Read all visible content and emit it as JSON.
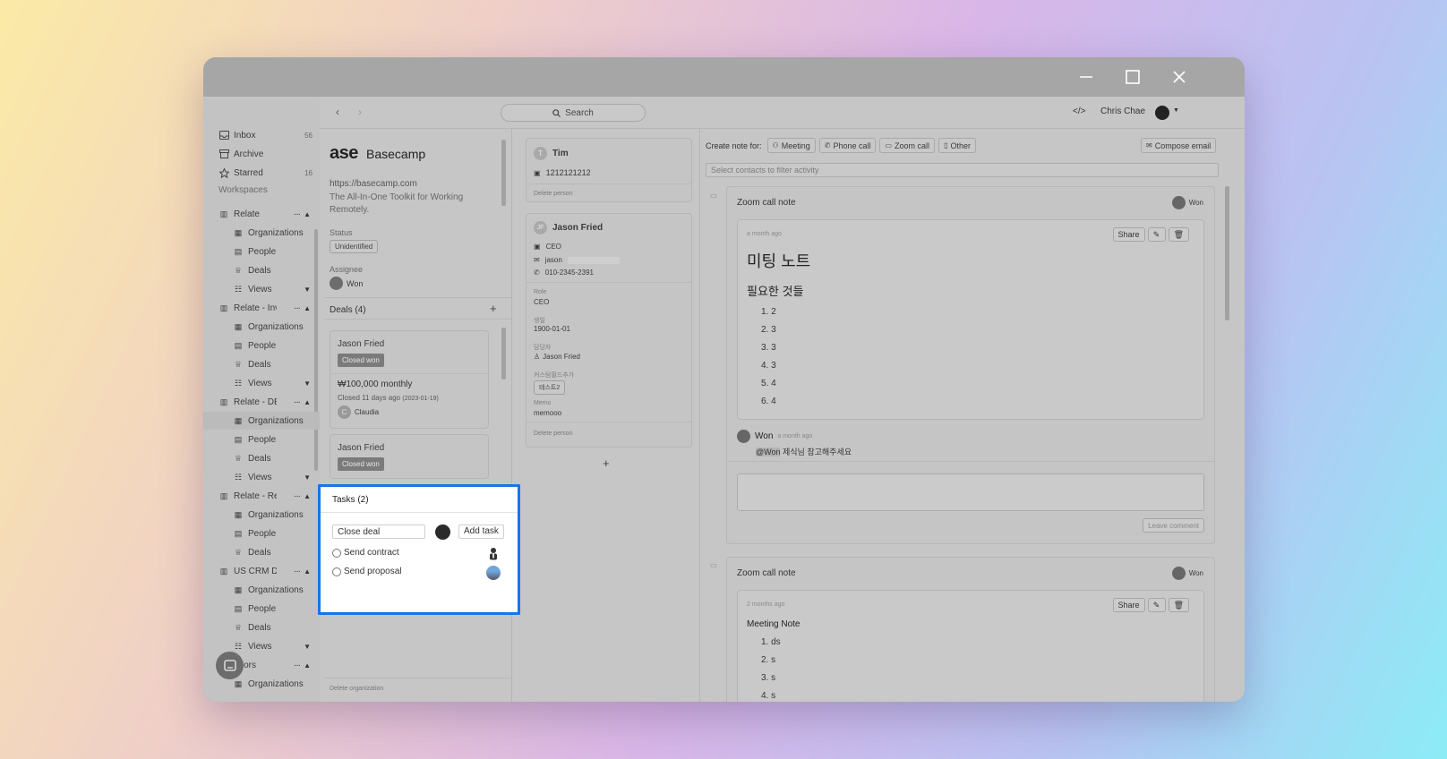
{
  "window": {
    "minimize_label": "—",
    "maximize_label": "☐",
    "close_label": "✕"
  },
  "sidebar": {
    "inbox": {
      "label": "Inbox",
      "count": "56"
    },
    "archive": {
      "label": "Archive"
    },
    "starred": {
      "label": "Starred",
      "count": "16"
    },
    "workspaces_label": "Workspaces",
    "workspaces": [
      {
        "name": "Relate",
        "items": [
          "Organizations",
          "People",
          "Deals",
          "Views"
        ]
      },
      {
        "name": "Relate - Inve",
        "items": [
          "Organizations",
          "People",
          "Deals",
          "Views"
        ]
      },
      {
        "name": "Relate - DEM",
        "items": [
          "Organizations",
          "People",
          "Deals",
          "Views"
        ]
      },
      {
        "name": "Relate - Recr",
        "items": [
          "Organizations",
          "People",
          "Deals"
        ]
      },
      {
        "name": "US CRM Den",
        "items": [
          "Organizations",
          "People",
          "Deals",
          "Views"
        ]
      },
      {
        "name": "ndors",
        "items": [
          "Organizations"
        ]
      }
    ]
  },
  "topnav": {
    "search_label": "Search",
    "user_name": "Chris Chae"
  },
  "organization": {
    "logo_text": "ase",
    "name": "Basecamp",
    "url": "https://basecamp.com",
    "description": "The All-In-One Toolkit for Working Remotely.",
    "status_label": "Status",
    "status_value": "Unidentified",
    "assignee_label": "Assignee",
    "assignee_value": "Won",
    "deals_header": "Deals (4)",
    "add_label": "+",
    "deals": [
      {
        "person": "Jason Fried",
        "stage": "Closed won",
        "amount": "₩100,000 monthly",
        "closed": "Closed 11 days ago",
        "closed_date": "(2023-01-19)",
        "owner_initial": "C",
        "owner": "Claudia"
      },
      {
        "person": "Jason Fried",
        "stage": "Closed won"
      }
    ],
    "delete_label": "Delete organization"
  },
  "tasks": {
    "header": "Tasks (2)",
    "input_value": "Close deal",
    "add_task_label": "Add task",
    "items": [
      {
        "label": "Send contract"
      },
      {
        "label": "Send proposal"
      }
    ]
  },
  "people": [
    {
      "initial": "T",
      "name": "Tim",
      "phone": "1212121212",
      "delete_label": "Delete person"
    },
    {
      "initial": "JF",
      "name": "Jason Fried",
      "title": "CEO",
      "email": "jason",
      "phone": "010-2345-2391",
      "fields": [
        {
          "label": "Role",
          "value": "CEO"
        },
        {
          "label": "생일",
          "value": "1900-01-01"
        },
        {
          "label": "담당자",
          "value": "Jason Fried"
        },
        {
          "label": "커스텀필드추가",
          "value": "테스트2"
        },
        {
          "label": "Memo",
          "value": "memooo"
        }
      ],
      "delete_label": "Delete person"
    }
  ],
  "people_add_label": "+",
  "activity": {
    "create_note_label": "Create note for:",
    "note_types": [
      "Meeting",
      "Phone call",
      "Zoom call",
      "Other"
    ],
    "compose_email_label": "Compose email",
    "filter_placeholder": "Select contacts to filter activity",
    "notes": [
      {
        "title": "Zoom call note",
        "author": "Won",
        "time": "a month ago",
        "share_label": "Share",
        "heading1": "미팅 노트",
        "heading2": "필요한 것들",
        "list": [
          "1. 2",
          "2. 3",
          "3. 3",
          "4. 3",
          "5. 4",
          "6. 4"
        ],
        "comment": {
          "author": "Won",
          "time": "a month ago",
          "mention": "@Won",
          "text": " 제식님 참고해주세요"
        },
        "leave_comment_label": "Leave comment"
      },
      {
        "title": "Zoom call note",
        "author": "Won",
        "time": "2 months ago",
        "share_label": "Share",
        "body_title": "Meeting Note",
        "list": [
          "1. ds",
          "2. s",
          "3. s",
          "4. s"
        ]
      }
    ]
  },
  "chat_widget_label": "chat"
}
